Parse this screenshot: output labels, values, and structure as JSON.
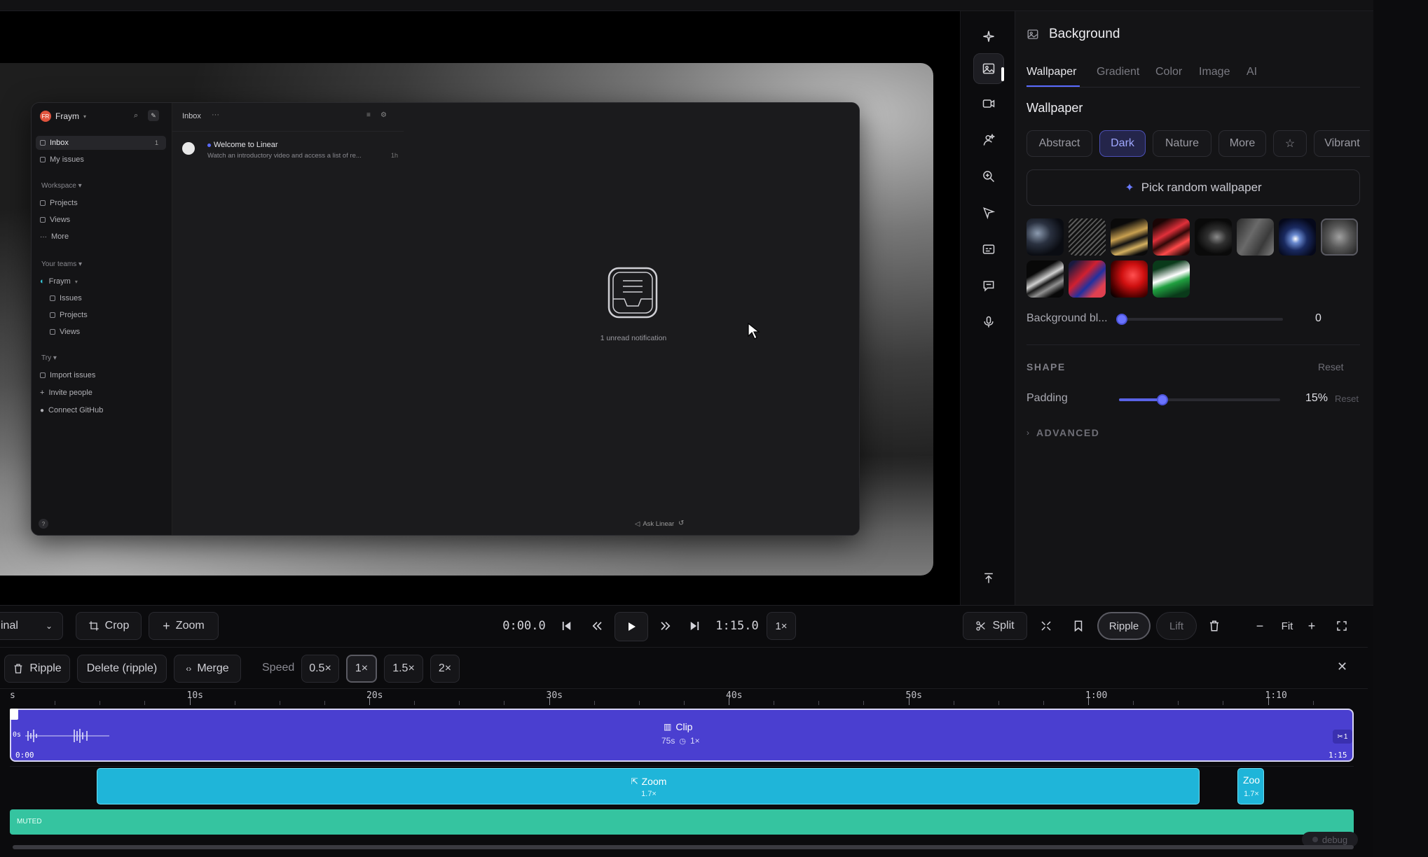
{
  "preview": {
    "app": {
      "workspace_name": "Fraym",
      "workspace_initials": "FR",
      "nav": [
        {
          "label": "Inbox",
          "count": "1"
        },
        {
          "label": "My issues"
        }
      ],
      "workspace_heading": "Workspace",
      "workspace_items": [
        "Projects",
        "Views",
        "More"
      ],
      "teams_heading": "Your teams",
      "team_name": "Fraym",
      "team_items": [
        "Issues",
        "Projects",
        "Views"
      ],
      "try_heading": "Try",
      "try_items": [
        "Import issues",
        "Invite people",
        "Connect GitHub"
      ],
      "help": "?",
      "inbox_title": "Inbox",
      "inbox_more": "···",
      "message_title": "Welcome to Linear",
      "message_preview": "Watch an introductory video and access a list of re...",
      "message_time": "1h",
      "empty_text": "1 unread notification",
      "ask": "Ask Linear"
    }
  },
  "panel": {
    "title": "Background",
    "tabs": [
      "Wallpaper",
      "Gradient",
      "Color",
      "Image",
      "AI"
    ],
    "active_tab": "Wallpaper",
    "section_title": "Wallpaper",
    "categories": [
      "Abstract",
      "Dark",
      "Nature",
      "More",
      "Vibrant"
    ],
    "active_category": "Dark",
    "pick_random": "Pick random wallpaper",
    "blur_label": "Background bl...",
    "blur_value": "0",
    "blur_level": 0,
    "shape_heading": "SHAPE",
    "reset": "Reset",
    "padding_label": "Padding",
    "padding_value": "15%",
    "padding_level": 0.27,
    "advanced": "ADVANCED"
  },
  "toolbar": {
    "tools": [
      "sparkle-icon",
      "image-icon",
      "video-icon",
      "person-icon",
      "zoom-in-icon",
      "cursor-icon",
      "caption-icon",
      "comment-icon",
      "microphone-icon",
      "arrow-up-icon"
    ]
  },
  "controls": {
    "aspect": "inal",
    "crop": "Crop",
    "zoom": "Zoom",
    "current_time": "0:00.0",
    "total_time": "1:15.0",
    "speed_badge": "1×",
    "split": "Split",
    "ripple": "Ripple",
    "lift": "Lift",
    "fit": "Fit"
  },
  "clip_toolbar": {
    "ripple": "Ripple",
    "delete_ripple": "Delete (ripple)",
    "merge": "Merge",
    "speed_label": "Speed",
    "speeds": [
      "0.5×",
      "1×",
      "1.5×",
      "2×"
    ],
    "selected_speed": "1×"
  },
  "timeline": {
    "ruler_start": "s",
    "ticks": [
      "10s",
      "20s",
      "30s",
      "40s",
      "50s",
      "1:00",
      "1:10"
    ],
    "clip": {
      "label": "Clip",
      "duration": "75s",
      "speed": "1×",
      "start": "0:00",
      "end": "1:15",
      "left_marker": "0s",
      "right_marker": "1"
    },
    "zoom_main": {
      "label": "Zoom",
      "factor": "1.7×"
    },
    "zoom_small": {
      "label": "Zoo",
      "factor": "1.7×"
    },
    "audio_label": "MUTED",
    "debug": "debug"
  },
  "colors": {
    "accent": "#5a6bff",
    "clip": "#4a3fd0",
    "zoom": "#1fb5d9",
    "audio": "#35c4a0"
  }
}
